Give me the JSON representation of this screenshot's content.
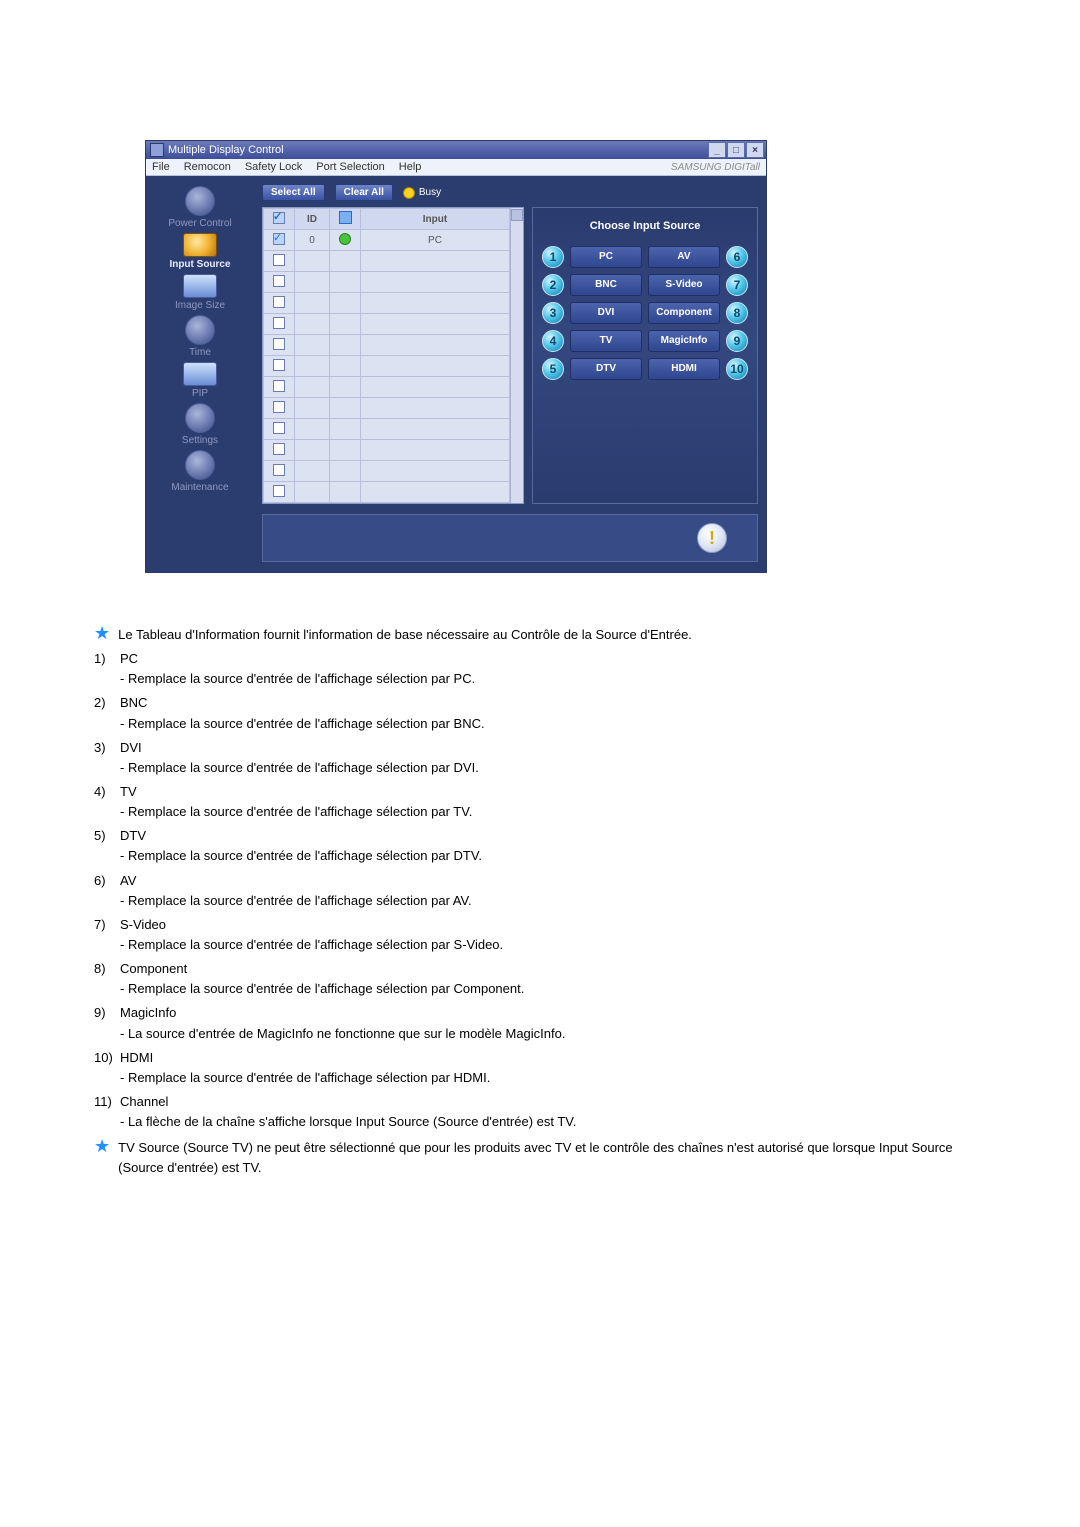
{
  "window": {
    "title": "Multiple Display Control",
    "menus": [
      "File",
      "Remocon",
      "Safety Lock",
      "Port Selection",
      "Help"
    ],
    "brand": "SAMSUNG DIGITall"
  },
  "nav": {
    "items": [
      {
        "label": "Power Control"
      },
      {
        "label": "Input Source",
        "active": true
      },
      {
        "label": "Image Size"
      },
      {
        "label": "Time"
      },
      {
        "label": "PIP"
      },
      {
        "label": "Settings"
      },
      {
        "label": "Maintenance"
      }
    ]
  },
  "toolbar": {
    "select_all": "Select All",
    "clear_all": "Clear All",
    "busy": "Busy"
  },
  "table": {
    "headers": [
      "",
      "ID",
      "",
      "Input"
    ],
    "rows": [
      {
        "checked": true,
        "id": "0",
        "status": true,
        "input": "PC"
      },
      {
        "checked": false,
        "id": "",
        "status": false,
        "input": ""
      },
      {
        "checked": false,
        "id": "",
        "status": false,
        "input": ""
      },
      {
        "checked": false,
        "id": "",
        "status": false,
        "input": ""
      },
      {
        "checked": false,
        "id": "",
        "status": false,
        "input": ""
      },
      {
        "checked": false,
        "id": "",
        "status": false,
        "input": ""
      },
      {
        "checked": false,
        "id": "",
        "status": false,
        "input": ""
      },
      {
        "checked": false,
        "id": "",
        "status": false,
        "input": ""
      },
      {
        "checked": false,
        "id": "",
        "status": false,
        "input": ""
      },
      {
        "checked": false,
        "id": "",
        "status": false,
        "input": ""
      },
      {
        "checked": false,
        "id": "",
        "status": false,
        "input": ""
      },
      {
        "checked": false,
        "id": "",
        "status": false,
        "input": ""
      },
      {
        "checked": false,
        "id": "",
        "status": false,
        "input": ""
      }
    ]
  },
  "source_panel": {
    "title": "Choose Input Source",
    "left": [
      {
        "n": "1",
        "label": "PC"
      },
      {
        "n": "2",
        "label": "BNC"
      },
      {
        "n": "3",
        "label": "DVI"
      },
      {
        "n": "4",
        "label": "TV"
      },
      {
        "n": "5",
        "label": "DTV"
      }
    ],
    "right": [
      {
        "n": "6",
        "label": "AV"
      },
      {
        "n": "7",
        "label": "S-Video"
      },
      {
        "n": "8",
        "label": "Component"
      },
      {
        "n": "9",
        "label": "MagicInfo"
      },
      {
        "n": "10",
        "label": "HDMI"
      }
    ]
  },
  "text": {
    "intro": "Le Tableau d'Information fournit l'information de base nécessaire au Contrôle de la Source d'Entrée.",
    "items": [
      {
        "n": "1)",
        "t": "PC",
        "d": "- Remplace la source d'entrée de l'affichage sélection par PC."
      },
      {
        "n": "2)",
        "t": "BNC",
        "d": "- Remplace la source d'entrée de l'affichage sélection par BNC."
      },
      {
        "n": "3)",
        "t": "DVI",
        "d": "- Remplace la source d'entrée de l'affichage sélection par DVI."
      },
      {
        "n": "4)",
        "t": "TV",
        "d": "- Remplace la source d'entrée de l'affichage sélection par TV."
      },
      {
        "n": "5)",
        "t": "DTV",
        "d": "- Remplace la source d'entrée de l'affichage sélection par DTV."
      },
      {
        "n": "6)",
        "t": "AV",
        "d": "- Remplace la source d'entrée de l'affichage sélection par AV."
      },
      {
        "n": "7)",
        "t": "S-Video",
        "d": "- Remplace la source d'entrée de l'affichage sélection par S-Video."
      },
      {
        "n": "8)",
        "t": "Component",
        "d": "- Remplace la source d'entrée de l'affichage sélection par Component."
      },
      {
        "n": "9)",
        "t": "MagicInfo",
        "d": "- La source d'entrée de MagicInfo ne fonctionne que sur le modèle MagicInfo."
      },
      {
        "n": "10)",
        "t": "HDMI",
        "d": "- Remplace la source d'entrée de l'affichage sélection par HDMI."
      },
      {
        "n": "11)",
        "t": "Channel",
        "d": "- La flèche de la chaîne s'affiche lorsque Input Source (Source d'entrée) est TV."
      }
    ],
    "footnote": "TV Source (Source TV) ne peut être sélectionné que pour les produits avec TV et le contrôle des chaînes n'est autorisé que lorsque Input Source (Source d'entrée) est TV."
  }
}
